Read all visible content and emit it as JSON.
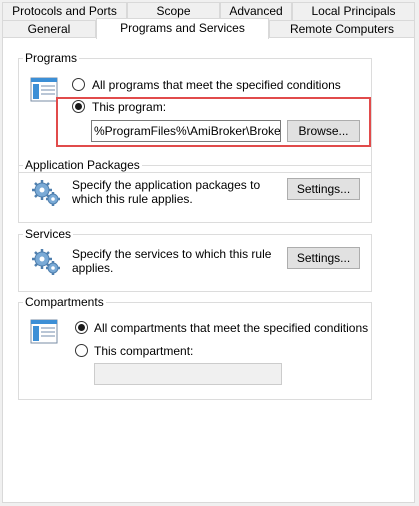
{
  "tabs": {
    "row1": [
      "Protocols and Ports",
      "Scope",
      "Advanced",
      "Local Principals"
    ],
    "row2": [
      "General",
      "Programs and Services",
      "Remote Computers"
    ],
    "active": "Programs and Services"
  },
  "programs": {
    "title": "Programs",
    "option_all": "All programs that meet the specified conditions",
    "option_this": "This program:",
    "selected": "option_this",
    "path_value": "%ProgramFiles%\\AmiBroker\\Broker.exe",
    "browse_label": "Browse..."
  },
  "packages": {
    "title": "Application Packages",
    "description": "Specify the application packages to which this rule applies.",
    "settings_label": "Settings..."
  },
  "services": {
    "title": "Services",
    "description": "Specify the services to which this rule applies.",
    "settings_label": "Settings..."
  },
  "compartments": {
    "title": "Compartments",
    "option_all": "All compartments that meet the specified conditions",
    "option_this": "This compartment:",
    "selected": "option_all",
    "compartment_value": ""
  },
  "colors": {
    "highlight": "#e14b4b",
    "accent": "#3c8fd6"
  },
  "icons": {
    "programs": "application-window-icon",
    "packages": "gears-icon",
    "services": "gears-icon",
    "compartments": "application-window-icon"
  }
}
